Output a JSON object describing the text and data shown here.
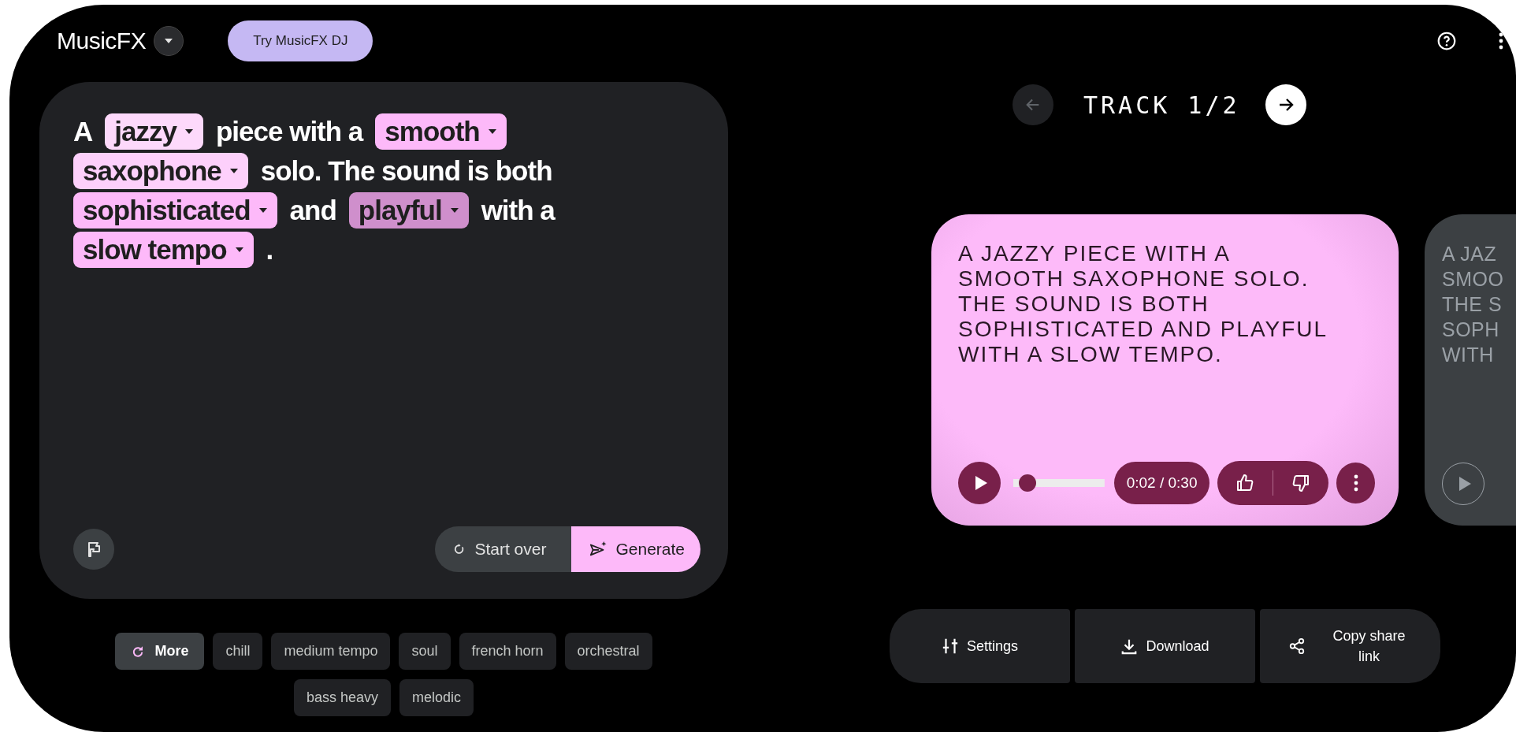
{
  "header": {
    "app_name": "MusicFX",
    "dj_button": "Try MusicFX DJ"
  },
  "prompt": {
    "lines": [
      [
        {
          "kind": "text",
          "text": "A"
        },
        {
          "kind": "chip",
          "text": "jazzy",
          "color": "#fdd9fb"
        },
        {
          "kind": "text",
          "text": "piece with a"
        },
        {
          "kind": "chip",
          "text": "smooth",
          "color": "#fdb9f9"
        }
      ],
      [
        {
          "kind": "chip",
          "text": "saxophone",
          "color": "#fdd0fb"
        },
        {
          "kind": "text",
          "text": "solo. The sound is both"
        }
      ],
      [
        {
          "kind": "chip",
          "text": "sophisticated",
          "color": "#fdb9f9"
        },
        {
          "kind": "text",
          "text": "and"
        },
        {
          "kind": "chip",
          "text": "playful",
          "color": "#cf8fcc"
        },
        {
          "kind": "text",
          "text": "with a"
        }
      ],
      [
        {
          "kind": "chip",
          "text": "slow tempo",
          "color": "#fdb9f9"
        },
        {
          "kind": "text",
          "text": "."
        }
      ]
    ],
    "start_over": "Start over",
    "generate": "Generate"
  },
  "suggestions": {
    "more": "More",
    "chips": [
      "chill",
      "medium tempo",
      "soul",
      "french horn",
      "orchestral",
      "bass heavy",
      "melodic"
    ]
  },
  "track_nav": {
    "label": "TRACK 1/2"
  },
  "tracks": [
    {
      "active": true,
      "lines": [
        "A JAZZY PIECE WITH A",
        "SMOOTH SAXOPHONE SOLO.",
        "THE SOUND IS BOTH",
        "SOPHISTICATED AND PLAYFUL",
        "WITH A SLOW TEMPO."
      ],
      "level": 0.07,
      "time": "0:02 / 0:30"
    },
    {
      "active": false,
      "lines": [
        "A JAZ",
        "SMOO",
        "THE S",
        "SOPH",
        "WITH"
      ]
    }
  ],
  "actions": [
    {
      "kind": "settings",
      "label": "Settings"
    },
    {
      "kind": "download",
      "label": "Download"
    },
    {
      "kind": "share",
      "label": "Copy share link"
    }
  ]
}
